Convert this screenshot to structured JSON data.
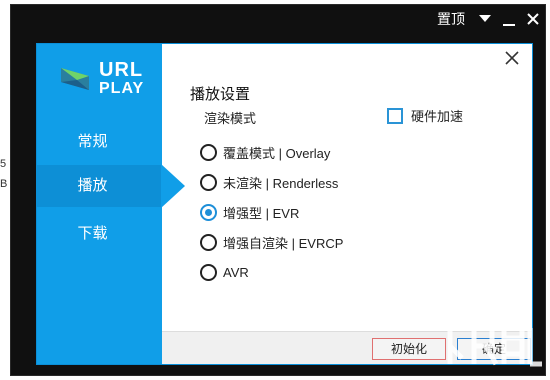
{
  "backdrop": {
    "edge_glyphs": [
      "5",
      "B"
    ]
  },
  "titlebar": {
    "pin_label": "置顶"
  },
  "logo": {
    "line1": "URL",
    "line2": "PLAY"
  },
  "sidebar": {
    "items": [
      {
        "label": "常规"
      },
      {
        "label": "播放"
      },
      {
        "label": "下载"
      }
    ],
    "active_index": 1
  },
  "main": {
    "section_title": "播放设置",
    "render_mode_label": "渲染模式",
    "hw_accel_label": "硬件加速",
    "hw_accel_checked": false,
    "render_options": [
      {
        "label": "覆盖模式 | Overlay"
      },
      {
        "label": "未渲染 | Renderless"
      },
      {
        "label": "增强型 | EVR"
      },
      {
        "label": "增强自渲染 | EVRCP"
      },
      {
        "label": "AVR"
      }
    ],
    "selected_index": 2
  },
  "footer": {
    "init_label": "初始化",
    "ok_label": "确定"
  },
  "colors": {
    "accent": "#109ee8",
    "radio_selected": "#1e8fd8"
  },
  "icons": {
    "pin": "pin-label",
    "dropdown": "triangle-down-icon",
    "minimize": "minimize-icon",
    "close": "close-icon",
    "dialog_close": "close-x-icon",
    "logo": "urlplay-logo-icon"
  }
}
